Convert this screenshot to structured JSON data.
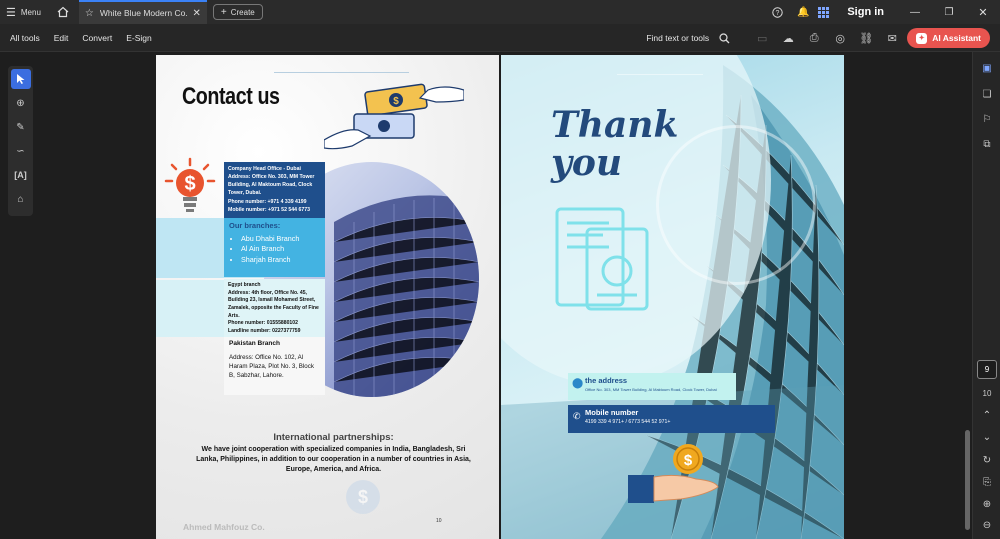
{
  "tabbar": {
    "menu_label": "Menu",
    "tab_title": "White Blue Modern Co...",
    "create_label": "Create",
    "sign_in": "Sign in"
  },
  "toolbar": {
    "menus": [
      "All tools",
      "Edit",
      "Convert",
      "E-Sign"
    ],
    "find_label": "Find text or tools",
    "ai_label": "AI Assistant"
  },
  "nav": {
    "current_page": "9",
    "next_page": "10"
  },
  "left_page": {
    "title": "Contact us",
    "head_office": {
      "heading": "Company Head Office - Dubai",
      "address": "Address: Office No. 303, MM Tower Building, Al Maktoum Road, Clock Tower, Dubai.",
      "phone": "Phone number: +971 4 339 4199",
      "mobile": "Mobile number: +971 52 544 6773"
    },
    "branches_heading": "Our branches:",
    "branches": [
      "Abu Dhabi Branch",
      "Al Ain Branch",
      "Sharjah Branch"
    ],
    "egypt": {
      "heading": "Egypt branch",
      "body": "Address: 4th floor, Office No. 45, Building 23, Ismail Mohamed Street, Zamalek, opposite the Faculty of Fine Arts.",
      "phone": "Phone number: 01555880102",
      "landline": "Landline number: 0227377759"
    },
    "pakistan": {
      "heading": "Pakistan Branch",
      "body": "Address: Office No. 102, Al Haram Plaza, Plot No. 3, Block B, Sabzhar, Lahore."
    },
    "partnerships_heading": "International partnerships:",
    "partnerships_body": "We have joint cooperation with specialized companies in India, Bangladesh, Sri Lanka, Philippines, in addition to our cooperation in a number of countries in Asia, Europe, America, and Africa.",
    "footer_brand": "Ahmed Mahfouz Co.",
    "page_number": "10"
  },
  "right_page": {
    "thank_line1": "Thank",
    "thank_line2": "you",
    "address_label": "the address",
    "address_value": "Office No. 303, MM Tower Building, Al Maktoum Road, Clock Tower, Dubai",
    "mobile_label": "Mobile number",
    "mobile_value": "4199 339 4 971+ / 6773 544 52 971+"
  }
}
